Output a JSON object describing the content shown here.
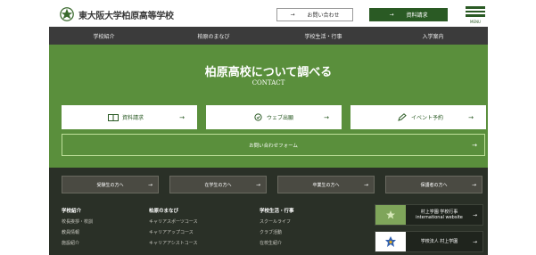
{
  "header": {
    "school_name": "東大阪大学柏原高等学校",
    "contact_label": "お問い合わせ",
    "request_label": "資料請求",
    "menu_label": "MENU",
    "arrow": "→"
  },
  "nav": {
    "items": [
      "学校紹介",
      "柏原のまなび",
      "学校生活・行事",
      "入学案内"
    ]
  },
  "contact_section": {
    "title": "柏原高校について調べる",
    "subtitle": "CONTACT",
    "buttons": [
      {
        "label": "資料請求",
        "icon": "document-icon"
      },
      {
        "label": "ウェブ出願",
        "icon": "web-icon"
      },
      {
        "label": "イベント予約",
        "icon": "pen-icon"
      }
    ],
    "form_label": "お問い合わせフォーム",
    "arrow": "→"
  },
  "info_buttons": [
    {
      "label": "受験生の方へ"
    },
    {
      "label": "在学生の方へ"
    },
    {
      "label": "卒業生の方へ"
    },
    {
      "label": "保護者の方へ"
    }
  ],
  "footer_columns": [
    {
      "heading": "学校紹介",
      "items": [
        "校長挨拶・校訓",
        "教員情報",
        "施設紹介"
      ]
    },
    {
      "heading": "柏原のまなび",
      "items": [
        "キャリアスポーツコース",
        "キャリアアップコース",
        "キャリアアシストコース"
      ]
    },
    {
      "heading": "学校生活・行事",
      "items": [
        "スクールライフ",
        "クラブ活動",
        "在校生紹介"
      ]
    }
  ],
  "banners": [
    {
      "line1": "村上学園 学校行事",
      "line2": "international website",
      "icon": "star-icon"
    },
    {
      "line1": "学校法人 村上学園",
      "line2": "",
      "icon": "emblem-icon"
    }
  ],
  "colors": {
    "brand_green": "#5a8f3c",
    "dark_green": "#2a5a24",
    "nav_bg": "#3b3b3b",
    "footer_bg": "#2a3027"
  }
}
